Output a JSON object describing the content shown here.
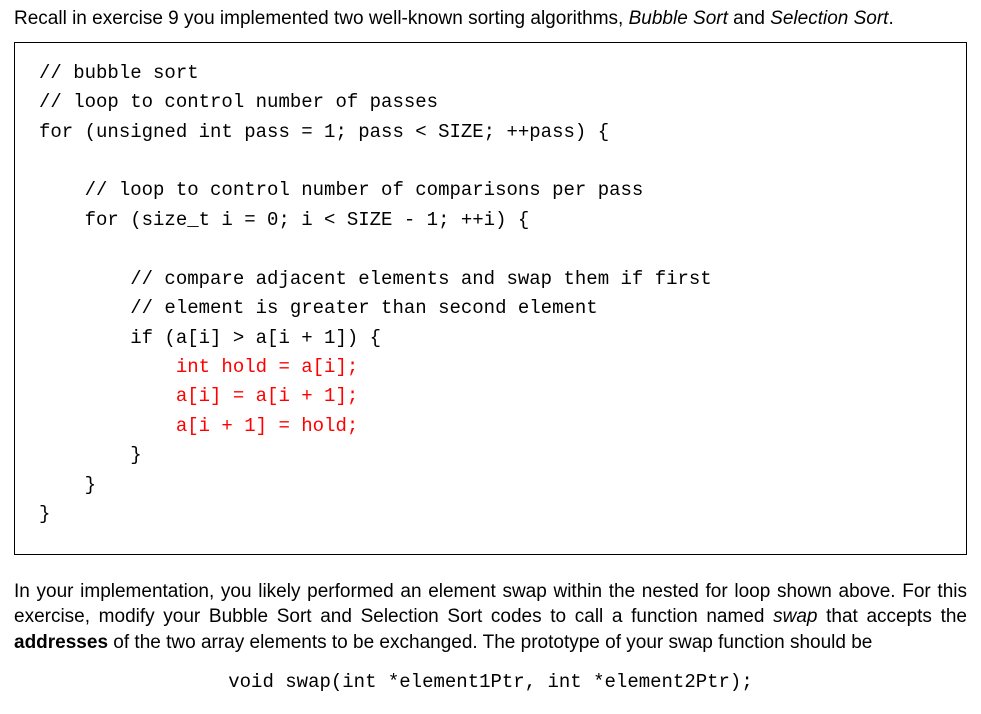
{
  "intro": {
    "prefix": "Recall in exercise 9 you implemented two well-known sorting algorithms, ",
    "alg1": "Bubble Sort",
    "mid": " and ",
    "alg2": "Selection Sort",
    "suffix": "."
  },
  "code": {
    "l1": "// bubble sort",
    "l2": "// loop to control number of passes",
    "l3": "for (unsigned int pass = 1; pass < SIZE; ++pass) {",
    "l4": "",
    "l5": "    // loop to control number of comparisons per pass",
    "l6": "    for (size_t i = 0; i < SIZE - 1; ++i) {",
    "l7": "",
    "l8": "        // compare adjacent elements and swap them if first",
    "l9": "        // element is greater than second element",
    "l10": "        if (a[i] > a[i + 1]) {",
    "l11pad": "            ",
    "l11": "int hold = a[i];",
    "l12pad": "            ",
    "l12": "a[i] = a[i + 1];",
    "l13pad": "            ",
    "l13": "a[i + 1] = hold;",
    "l14": "        }",
    "l15": "    }",
    "l16": "}"
  },
  "para": {
    "p1": "In your implementation, you likely performed an element swap within the nested for loop shown above.  For this exercise, modify your Bubble Sort and Selection Sort codes to call a function named ",
    "swap": "swap",
    "p2": " that accepts the ",
    "addresses": "addresses",
    "p3": " of the two array elements to be exchanged.  The prototype of your swap function should be"
  },
  "prototype": "void swap(int *element1Ptr, int *element2Ptr);"
}
